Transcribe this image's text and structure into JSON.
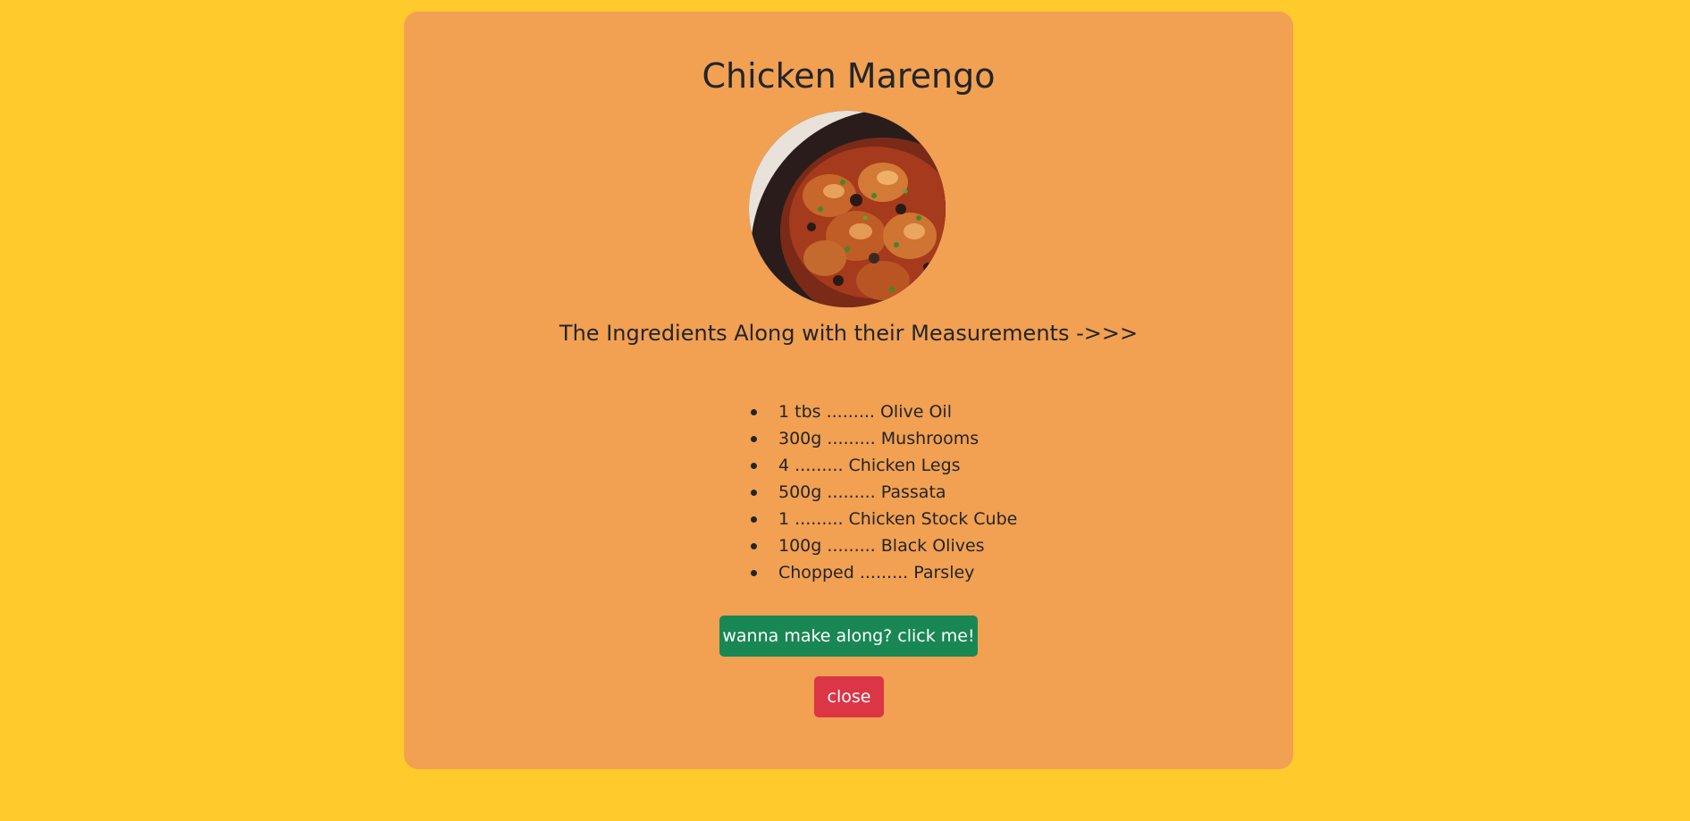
{
  "colors": {
    "page_background": "#ffca2c",
    "card_background": "#f2a052",
    "primary_button": "#198754",
    "close_button": "#dc3545",
    "text": "#212529"
  },
  "recipe": {
    "title": "Chicken Marengo",
    "image_icon": "recipe-photo",
    "subtitle": "The Ingredients Along with their Measurements ->>>",
    "ingredients": [
      "1 tbs ......... Olive Oil",
      "300g ......... Mushrooms",
      "4 ......... Chicken Legs",
      "500g ......... Passata",
      "1 ......... Chicken Stock Cube",
      "100g ......... Black Olives",
      "Chopped ......... Parsley"
    ]
  },
  "actions": {
    "make_along_label": "wanna make along? click me!",
    "close_label": "close"
  }
}
